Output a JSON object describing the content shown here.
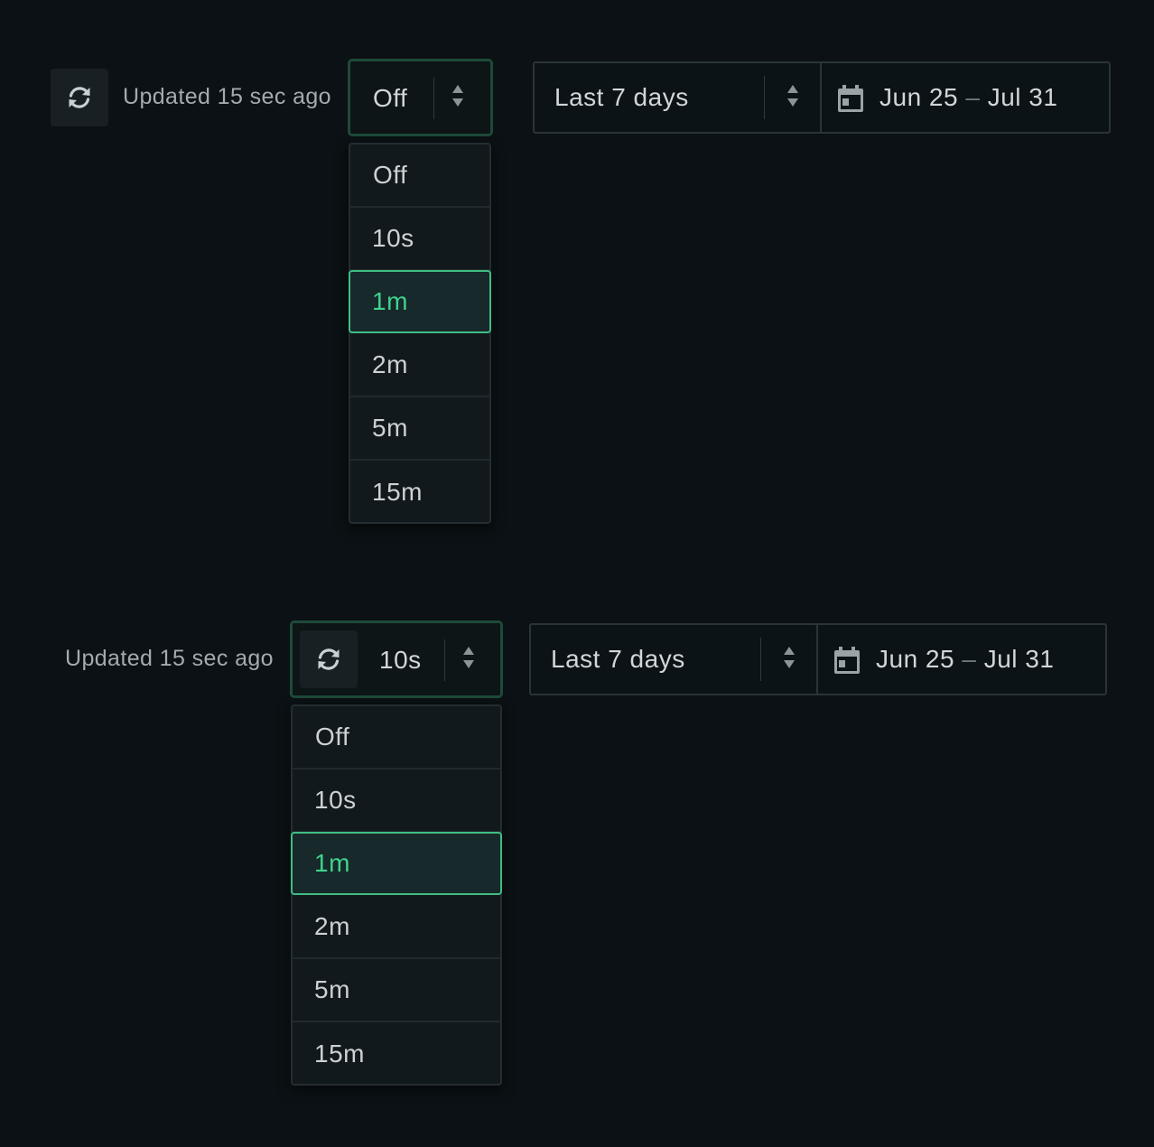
{
  "colors": {
    "background": "#0b1114",
    "accent": "#3fd28e",
    "select_border": "#1e4a39",
    "text": "#d1d6d8",
    "muted_text": "#a3abaf"
  },
  "icons": {
    "refresh": "refresh-icon",
    "stepper": "stepper-arrows-icon",
    "calendar": "calendar-icon"
  },
  "variant_a": {
    "updated_text": "Updated 15 sec ago",
    "refresh_select": {
      "value": "Off"
    },
    "range_select": {
      "value": "Last 7 days"
    },
    "date_start": "Jun 25",
    "date_separator": "–",
    "date_end": "Jul 31",
    "menu": {
      "options": [
        "Off",
        "10s",
        "1m",
        "2m",
        "5m",
        "15m"
      ],
      "highlighted": "1m"
    }
  },
  "variant_b": {
    "updated_text": "Updated 15 sec ago",
    "refresh_select": {
      "value": "10s"
    },
    "range_select": {
      "value": "Last 7 days"
    },
    "date_start": "Jun 25",
    "date_separator": "–",
    "date_end": "Jul 31",
    "menu": {
      "options": [
        "Off",
        "10s",
        "1m",
        "2m",
        "5m",
        "15m"
      ],
      "highlighted": "1m"
    }
  }
}
